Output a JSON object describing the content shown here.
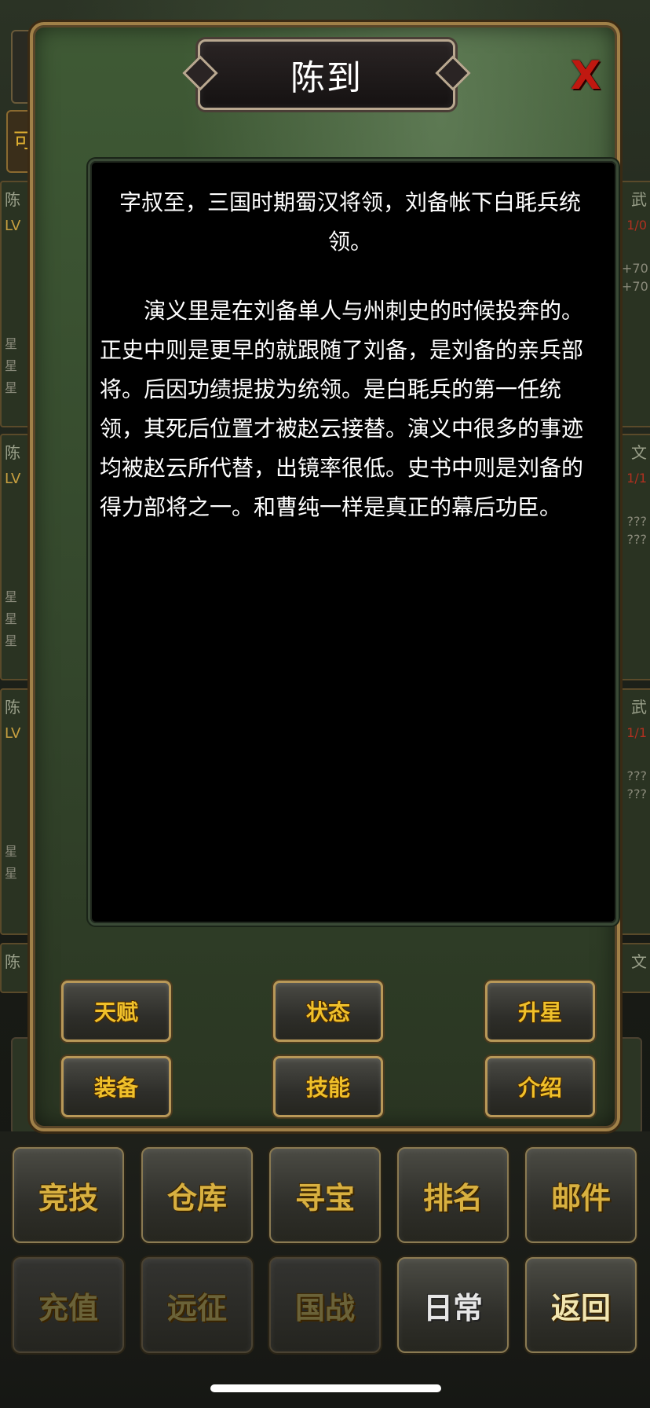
{
  "title": "陈到",
  "close_label": "X",
  "bio": [
    "字叔至，三国时期蜀汉将领，刘备帐下白毦兵统领。",
    "演义里是在刘备单人与州刺史的时候投奔的。正史中则是更早的就跟随了刘备，是刘备的亲兵部将。后因功绩提拔为统领。是白毦兵的第一任统领，其死后位置才被赵云接替。演义中很多的事迹均被赵云所代替，出镜率很低。史书中则是刘备的得力部将之一。和曹纯一样是真正的幕后功臣。"
  ],
  "panel_buttons": {
    "talent": "天赋",
    "status": "状态",
    "star_up": "升星",
    "equip": "装备",
    "skill": "技能",
    "intro": "介绍"
  },
  "menu": {
    "row1": [
      "竞技",
      "仓库",
      "寻宝",
      "排名",
      "邮件"
    ],
    "row2": [
      "充值",
      "远征",
      "国战",
      "日常",
      "返回"
    ]
  },
  "bg_cards": {
    "left_label": "陈",
    "left_lv": "LV",
    "left_star": "星",
    "right_labels": [
      "武",
      "文",
      "武",
      "文"
    ],
    "right_nums": [
      "1/0",
      "1/1",
      "1/1"
    ],
    "right_vals": [
      "+70",
      "+70",
      "???",
      "???",
      "???",
      "???"
    ],
    "top_btn2": "可"
  },
  "colors": {
    "panel_border": "#a08048",
    "button_text": "#f0c02a",
    "close": "#c01810"
  }
}
